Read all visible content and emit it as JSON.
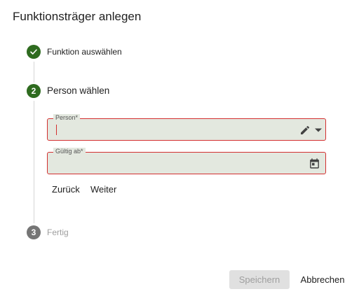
{
  "dialog": {
    "title": "Funktionsträger anlegen"
  },
  "stepper": {
    "steps": [
      {
        "number": "",
        "label": "Funktion auswählen",
        "state": "completed"
      },
      {
        "number": "2",
        "label": "Person wählen",
        "state": "active"
      },
      {
        "number": "3",
        "label": "Fertig",
        "state": "pending"
      }
    ]
  },
  "form": {
    "person": {
      "label": "Person*",
      "value": ""
    },
    "gueltig_ab": {
      "label": "Gültig ab*",
      "value": ""
    }
  },
  "step_actions": {
    "back_label": "Zurück",
    "next_label": "Weiter"
  },
  "footer": {
    "save_label": "Speichern",
    "cancel_label": "Abbrechen"
  },
  "colors": {
    "accent": "#2e6b1f",
    "error": "#d32f2f",
    "field_bg": "#e3e8df"
  },
  "icons": {
    "step1": "check-icon",
    "person_edit": "pencil-icon",
    "person_dropdown": "caret-down-icon",
    "date": "calendar-icon"
  }
}
